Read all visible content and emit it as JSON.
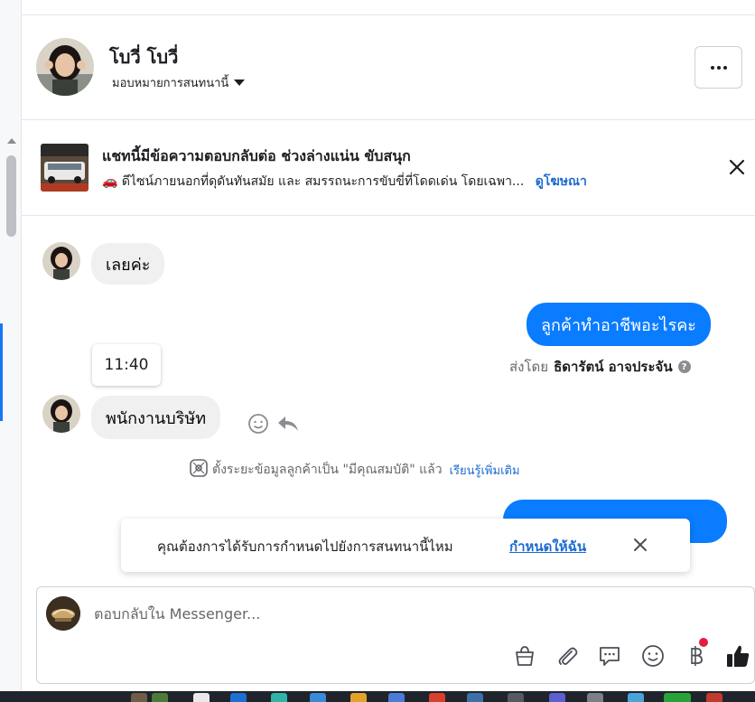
{
  "header": {
    "contact_name": "โบวี่ โบวี่",
    "assign_label": "มอบหมายการสนทนานี้"
  },
  "ad": {
    "title": "แชทนี้มีข้อความตอบกลับต่อ ช่วงล่างแน่น ขับสนุก",
    "description": "🚗 ดีไซน์ภายนอกที่ดุดันทันสมัย และ สมรรถนะการขับขี่ที่โดดเด่น โดยเฉพา...",
    "link_label": "ดูโฆษณา"
  },
  "messages": [
    {
      "direction": "incoming",
      "text": "เลยค่ะ"
    },
    {
      "direction": "outgoing",
      "text": "ลูกค้าทำอาชีพอะไรคะ",
      "sent_by_prefix": "ส่งโดย",
      "sent_by_name": "ธิดารัตน์ อาจประจัน"
    },
    {
      "direction": "incoming",
      "text": "พนักงานบริษัท",
      "time_tooltip": "11:40"
    }
  ],
  "system": {
    "text": "ตั้งระยะข้อมูลลูกค้าเป็น \"มีคุณสมบัติ\" แล้ว",
    "learn_more": "เรียนรู้เพิ่มเติม"
  },
  "toast": {
    "text": "คุณต้องการได้รับการกำหนดไปยังการสนทนานี้ไหม",
    "action": "กำหนดให้ฉัน"
  },
  "composer": {
    "placeholder": "ตอบกลับใน Messenger...",
    "value": ""
  },
  "colors": {
    "outgoing_bubble": "#0a7cff",
    "incoming_bubble": "#f0f0f0",
    "link": "#1b6bd1",
    "notification": "#e41e3f"
  },
  "icons": [
    "more-icon",
    "close-icon",
    "smile-icon",
    "reply-icon",
    "lead-icon",
    "help-icon",
    "bag-icon",
    "paperclip-icon",
    "saved-reply-icon",
    "emoji-icon",
    "baht-icon",
    "like-icon"
  ]
}
